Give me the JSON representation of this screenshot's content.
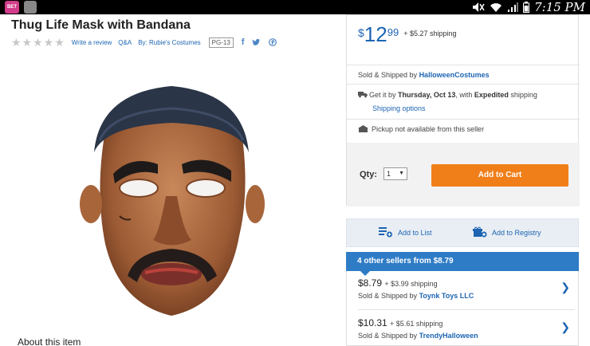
{
  "status_bar": {
    "time": "7:15 PM",
    "app1_label": "BET"
  },
  "product": {
    "title": "Thug Life Mask with Bandana",
    "write_review": "Write a review",
    "qa": "Q&A",
    "by_label": "By: Rubie's Costumes",
    "rating_badge": "PG-13",
    "rating_stars": 0,
    "about_heading": "About this item"
  },
  "buybox": {
    "price_symbol": "$",
    "price_dollars": "12",
    "price_cents": "99",
    "shipping_note": "+ $5.27 shipping",
    "sold_prefix": "Sold & Shipped by ",
    "seller": "HalloweenCostumes",
    "delivery_prefix": "Get it by ",
    "delivery_date": "Thursday, Oct 13",
    "delivery_mid": ", with ",
    "delivery_method": "Expedited",
    "delivery_suffix": " shipping",
    "shipping_options": "Shipping options",
    "pickup_note": "Pickup not available from this seller",
    "qty_label": "Qty:",
    "qty_value": "1",
    "add_to_cart": "Add to Cart"
  },
  "list_actions": {
    "add_to_list": "Add to List",
    "add_to_registry": "Add to Registry"
  },
  "other_sellers": {
    "header": "4 other sellers from $8.79",
    "offers": [
      {
        "price": "$8.79",
        "shipping": "+ $3.99 shipping",
        "sold_prefix": "Sold & Shipped by ",
        "seller": "Toynk Toys LLC"
      },
      {
        "price": "$10.31",
        "shipping": "+ $5.61 shipping",
        "sold_prefix": "Sold & Shipped by ",
        "seller": "TrendyHalloween"
      }
    ]
  },
  "colors": {
    "link_blue": "#1d65b2",
    "cart_orange": "#f07f1a",
    "sellers_header_blue": "#2f7cc6"
  }
}
